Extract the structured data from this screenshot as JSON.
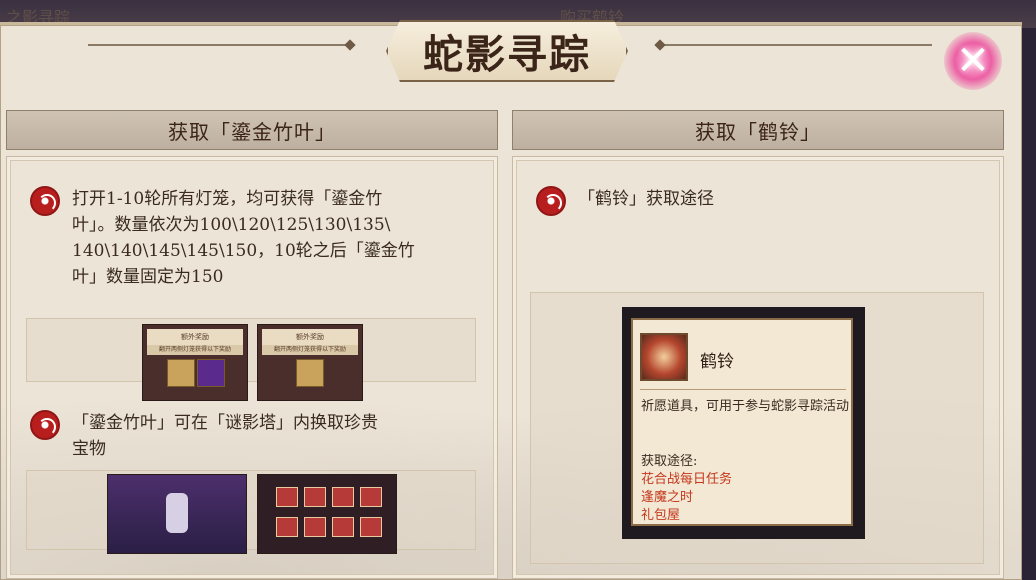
{
  "page": {
    "bg_tab_left": "之影寻踪",
    "bg_tab_right": "购买鹤铃",
    "title": "蛇影寻踪",
    "close_label": "✕"
  },
  "left": {
    "header": "获取「鎏金竹叶」",
    "para1_lines": [
      "打开1-10轮所有灯笼，均可获得「鎏金竹",
      "叶」。数量依次为100\\120\\125\\130\\135\\",
      "140\\140\\145\\145\\150，10轮之后「鎏金竹",
      "叶」数量固定为150"
    ],
    "thumb_title": "额外奖励",
    "thumb_sub": "翻开两侧灯笼获得以下奖励",
    "para2_lines": [
      "「鎏金竹叶」可在「谜影塔」内换取珍贵",
      "宝物"
    ]
  },
  "right": {
    "header": "获取「鹤铃」",
    "subtitle": "「鹤铃」获取途径",
    "item_name": "鹤铃",
    "item_desc": "祈愿道具，可用于参与蛇影寻踪活动",
    "source_label": "获取途径:",
    "sources": [
      "花合战每日任务",
      "逢魔之时",
      "礼包屋"
    ]
  },
  "colors": {
    "panel_bg": "#ece4d6",
    "header_bg": "#c7bbab",
    "accent_red": "#c4371c",
    "close_pink": "#ec5fa4"
  },
  "icons": {
    "close": "close-icon",
    "bullet": "seal-emblem-icon",
    "item": "crane-bell-icon"
  }
}
